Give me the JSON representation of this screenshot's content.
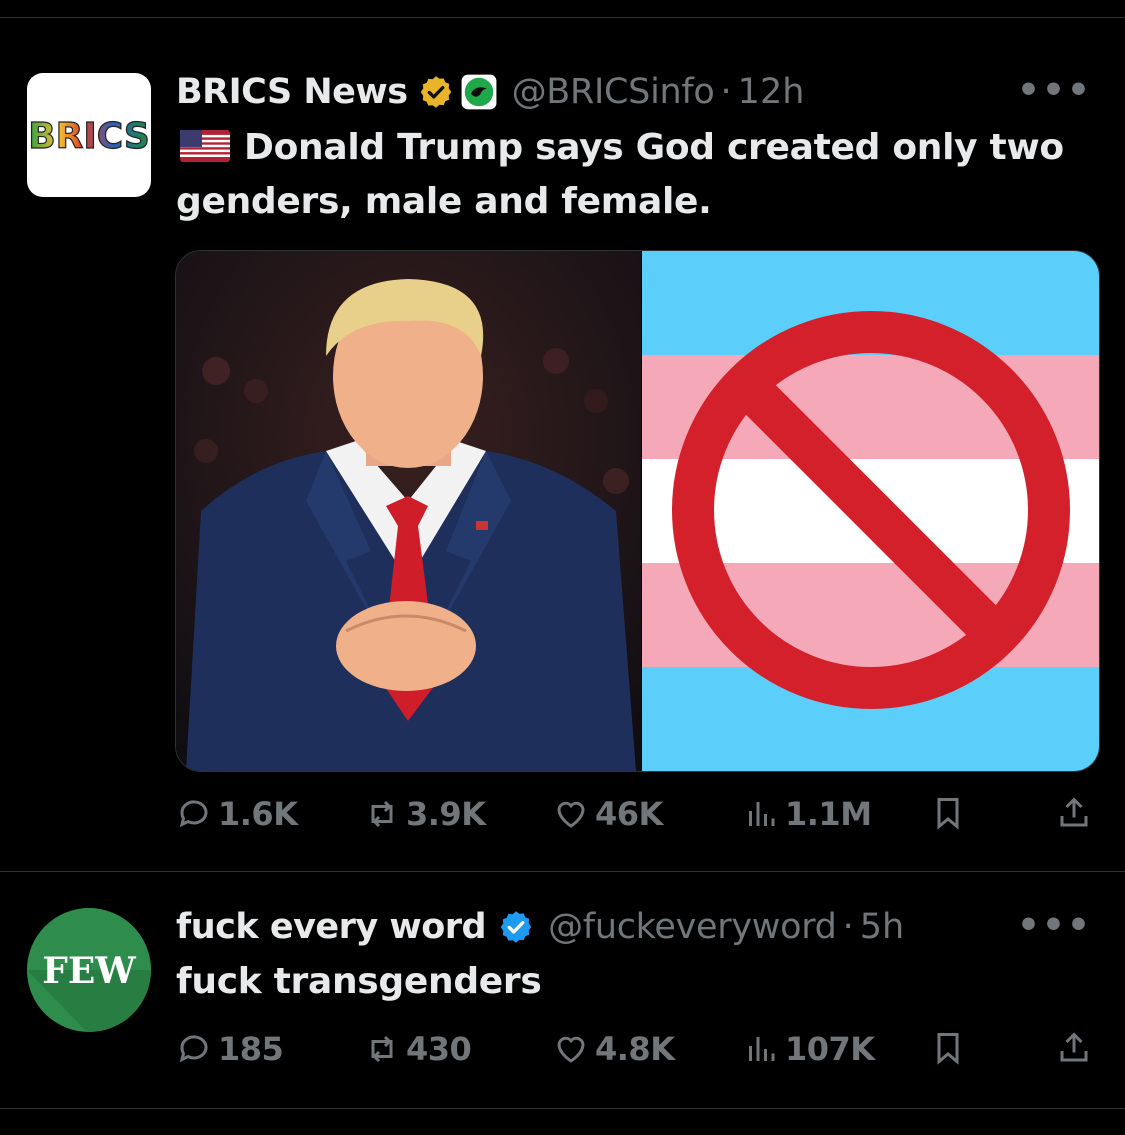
{
  "tweets": [
    {
      "avatar_text": "BRICS",
      "name": "BRICS News",
      "handle": "@BRICSinfo",
      "separator": "·",
      "time": "12h",
      "more_label": "•••",
      "text_flag": "🇺🇸",
      "text": "Donald Trump says God created only two genders, male and female.",
      "badges": [
        "gold-verified-badge",
        "affiliate-badge"
      ],
      "stats": {
        "replies": "1.6K",
        "retweets": "3.9K",
        "likes": "46K",
        "views": "1.1M"
      }
    },
    {
      "avatar_text": "FEW",
      "name": "fuck every word",
      "handle": "@fuckeveryword",
      "separator": "·",
      "time": "5h",
      "more_label": "•••",
      "text": "fuck transgenders",
      "badges": [
        "blue-verified-badge"
      ],
      "stats": {
        "replies": "185",
        "retweets": "430",
        "likes": "4.8K",
        "views": "107K"
      }
    }
  ],
  "colors": {
    "background": "#000000",
    "text": "#e7e9ea",
    "muted": "#71767b",
    "gold_badge": "#e8b52a",
    "blue_badge": "#1d9bf0",
    "trans_blue": "#5bcefa",
    "trans_pink": "#f5a9b8",
    "prohibit_red": "#d4202a"
  }
}
